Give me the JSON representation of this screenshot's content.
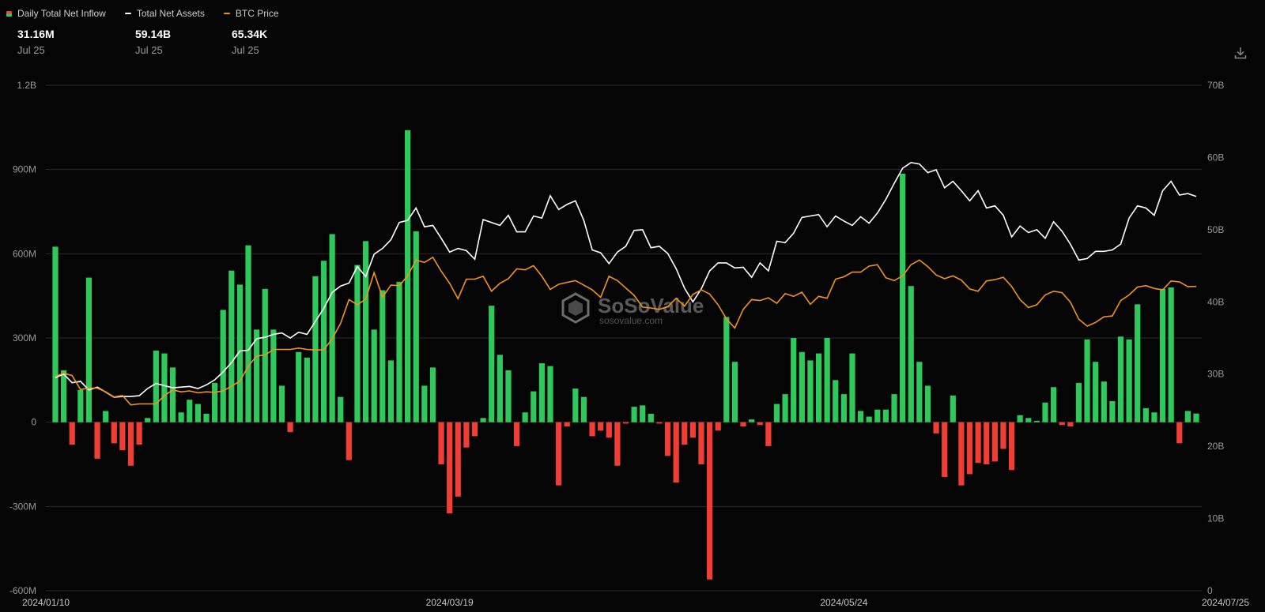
{
  "legend": {
    "inflow_label": "Daily Total Net Inflow",
    "assets_label": "Total Net Assets",
    "btc_label": "BTC Price"
  },
  "stats": {
    "inflow": {
      "value": "31.16M",
      "date": "Jul 25"
    },
    "assets": {
      "value": "59.14B",
      "date": "Jul 25"
    },
    "btc": {
      "value": "65.34K",
      "date": "Jul 25"
    }
  },
  "watermark": {
    "name": "SoSoValue",
    "url": "sosovalue.com"
  },
  "icons": {
    "download": "download-icon"
  },
  "colors": {
    "positive": "#2fc85a",
    "negative": "#f03e35",
    "assets": "#ffffff",
    "btc": "#f2941e",
    "grid": "#2a2a2a"
  },
  "chart_data": {
    "type": "bar",
    "grid": true,
    "legend_position": "top-left",
    "left_axis": {
      "ticks": [
        "1.2B",
        "900M",
        "600M",
        "300M",
        "0",
        "-300M",
        "-600M"
      ],
      "range_millions": [
        -600,
        1200
      ]
    },
    "right_axis": {
      "ticks": [
        "70B",
        "60B",
        "50B",
        "40B",
        "30B",
        "20B",
        "10B",
        "0"
      ],
      "range_billions": [
        0,
        70
      ]
    },
    "x_ticks": [
      "2024/01/10",
      "2024/03/19",
      "2024/05/24",
      "2024/07/25"
    ],
    "x_tick_indices": [
      0,
      47,
      94,
      140
    ],
    "series": [
      {
        "name": "Daily Total Net Inflow",
        "unit": "M",
        "values": [
          625,
          185,
          -80,
          115,
          515,
          -130,
          40,
          -75,
          -100,
          -155,
          -80,
          15,
          255,
          245,
          195,
          35,
          80,
          65,
          30,
          140,
          400,
          540,
          490,
          630,
          330,
          475,
          330,
          130,
          -35,
          250,
          230,
          520,
          575,
          670,
          90,
          -135,
          560,
          645,
          330,
          470,
          220,
          500,
          1040,
          680,
          130,
          195,
          -150,
          -325,
          -265,
          -90,
          -50,
          15,
          415,
          240,
          185,
          -85,
          35,
          110,
          210,
          200,
          -225,
          -15,
          120,
          90,
          -50,
          -30,
          -55,
          -155,
          -5,
          55,
          60,
          30,
          -5,
          -120,
          -215,
          -80,
          -55,
          -150,
          -560,
          -30,
          375,
          215,
          -15,
          10,
          -10,
          -85,
          65,
          100,
          300,
          250,
          220,
          245,
          300,
          150,
          100,
          245,
          40,
          20,
          45,
          45,
          100,
          885,
          485,
          215,
          130,
          -40,
          -195,
          95,
          -225,
          -185,
          -145,
          -150,
          -140,
          -95,
          -170,
          25,
          15,
          5,
          70,
          125,
          -10,
          -15,
          140,
          295,
          215,
          145,
          75,
          305,
          295,
          420,
          50,
          35,
          475,
          480,
          -75,
          40,
          31
        ]
      },
      {
        "name": "Total Net Assets",
        "unit": "B",
        "values": [
          29.5,
          30.0,
          28.8,
          29.0,
          27.8,
          28.2,
          27.5,
          26.8,
          26.9,
          26.9,
          27.0,
          28.0,
          28.7,
          28.4,
          28.1,
          28.2,
          28.3,
          28.0,
          28.5,
          29.2,
          30.3,
          31.6,
          33.2,
          33.3,
          34.9,
          35.1,
          35.5,
          35.7,
          35.0,
          35.8,
          35.5,
          37.3,
          39.1,
          41.3,
          42.2,
          42.6,
          44.9,
          43.5,
          46.6,
          47.4,
          48.6,
          51.0,
          51.3,
          53.0,
          50.4,
          50.6,
          48.8,
          46.9,
          47.4,
          47.1,
          45.9,
          51.4,
          51.0,
          50.6,
          52.0,
          49.7,
          49.7,
          51.9,
          51.6,
          54.7,
          52.8,
          53.5,
          54.0,
          51.3,
          47.2,
          46.8,
          45.3,
          46.9,
          47.7,
          49.9,
          50.0,
          47.5,
          47.7,
          46.7,
          44.6,
          41.9,
          40.0,
          41.8,
          44.3,
          45.4,
          45.4,
          44.7,
          44.8,
          43.4,
          45.4,
          44.3,
          48.4,
          48.2,
          49.5,
          51.7,
          51.9,
          52.1,
          50.4,
          51.9,
          51.2,
          50.6,
          51.8,
          50.9,
          52.3,
          54.2,
          56.4,
          58.5,
          59.3,
          59.1,
          57.9,
          58.3,
          55.8,
          56.7,
          55.4,
          54.0,
          55.4,
          53.0,
          53.3,
          52.0,
          49.0,
          50.5,
          49.6,
          50.0,
          48.8,
          51.1,
          49.8,
          48.0,
          45.8,
          46.0,
          47.0,
          47.0,
          47.2,
          48.0,
          51.6,
          53.3,
          53.0,
          52.0,
          55.4,
          56.7,
          54.8,
          55.0,
          54.6
        ]
      },
      {
        "name": "BTC Price",
        "unit": "K",
        "values": [
          46.0,
          46.7,
          46.2,
          43.2,
          43.5,
          43.5,
          42.7,
          41.6,
          41.9,
          39.9,
          40.1,
          40.1,
          40.1,
          41.9,
          43.1,
          42.7,
          42.9,
          42.5,
          42.7,
          42.6,
          42.9,
          43.9,
          45.0,
          48.2,
          50.4,
          50.6,
          51.8,
          51.8,
          51.8,
          52.1,
          51.8,
          51.7,
          51.7,
          54.1,
          57.4,
          62.5,
          61.4,
          62.6,
          68.3,
          63.0,
          65.6,
          65.5,
          67.6,
          71.0,
          70.5,
          71.6,
          68.6,
          66.0,
          62.7,
          66.9,
          66.9,
          67.5,
          64.3,
          66.0,
          67.0,
          69.1,
          68.9,
          69.8,
          67.5,
          64.7,
          65.8,
          66.2,
          66.6,
          65.6,
          64.6,
          63.0,
          67.5,
          66.6,
          65.0,
          63.4,
          60.9,
          60.7,
          60.4,
          61.0,
          62.8,
          61.1,
          63.6,
          64.6,
          63.7,
          61.4,
          58.4,
          56.4,
          60.4,
          62.5,
          62.3,
          62.9,
          61.7,
          63.8,
          63.2,
          64.1,
          61.5,
          63.2,
          62.8,
          66.9,
          67.4,
          68.4,
          68.4,
          69.7,
          70.0,
          67.2,
          66.6,
          67.6,
          70.0,
          71.0,
          69.6,
          67.8,
          67.0,
          67.6,
          66.7,
          64.8,
          64.3,
          66.5,
          66.8,
          67.3,
          65.3,
          62.5,
          60.8,
          61.4,
          63.5,
          64.3,
          64.0,
          62.0,
          58.3,
          56.8,
          57.6,
          58.8,
          59.0,
          62.3,
          63.5,
          65.2,
          65.5,
          64.9,
          64.6,
          66.5,
          66.3,
          65.3,
          65.34
        ]
      }
    ]
  }
}
